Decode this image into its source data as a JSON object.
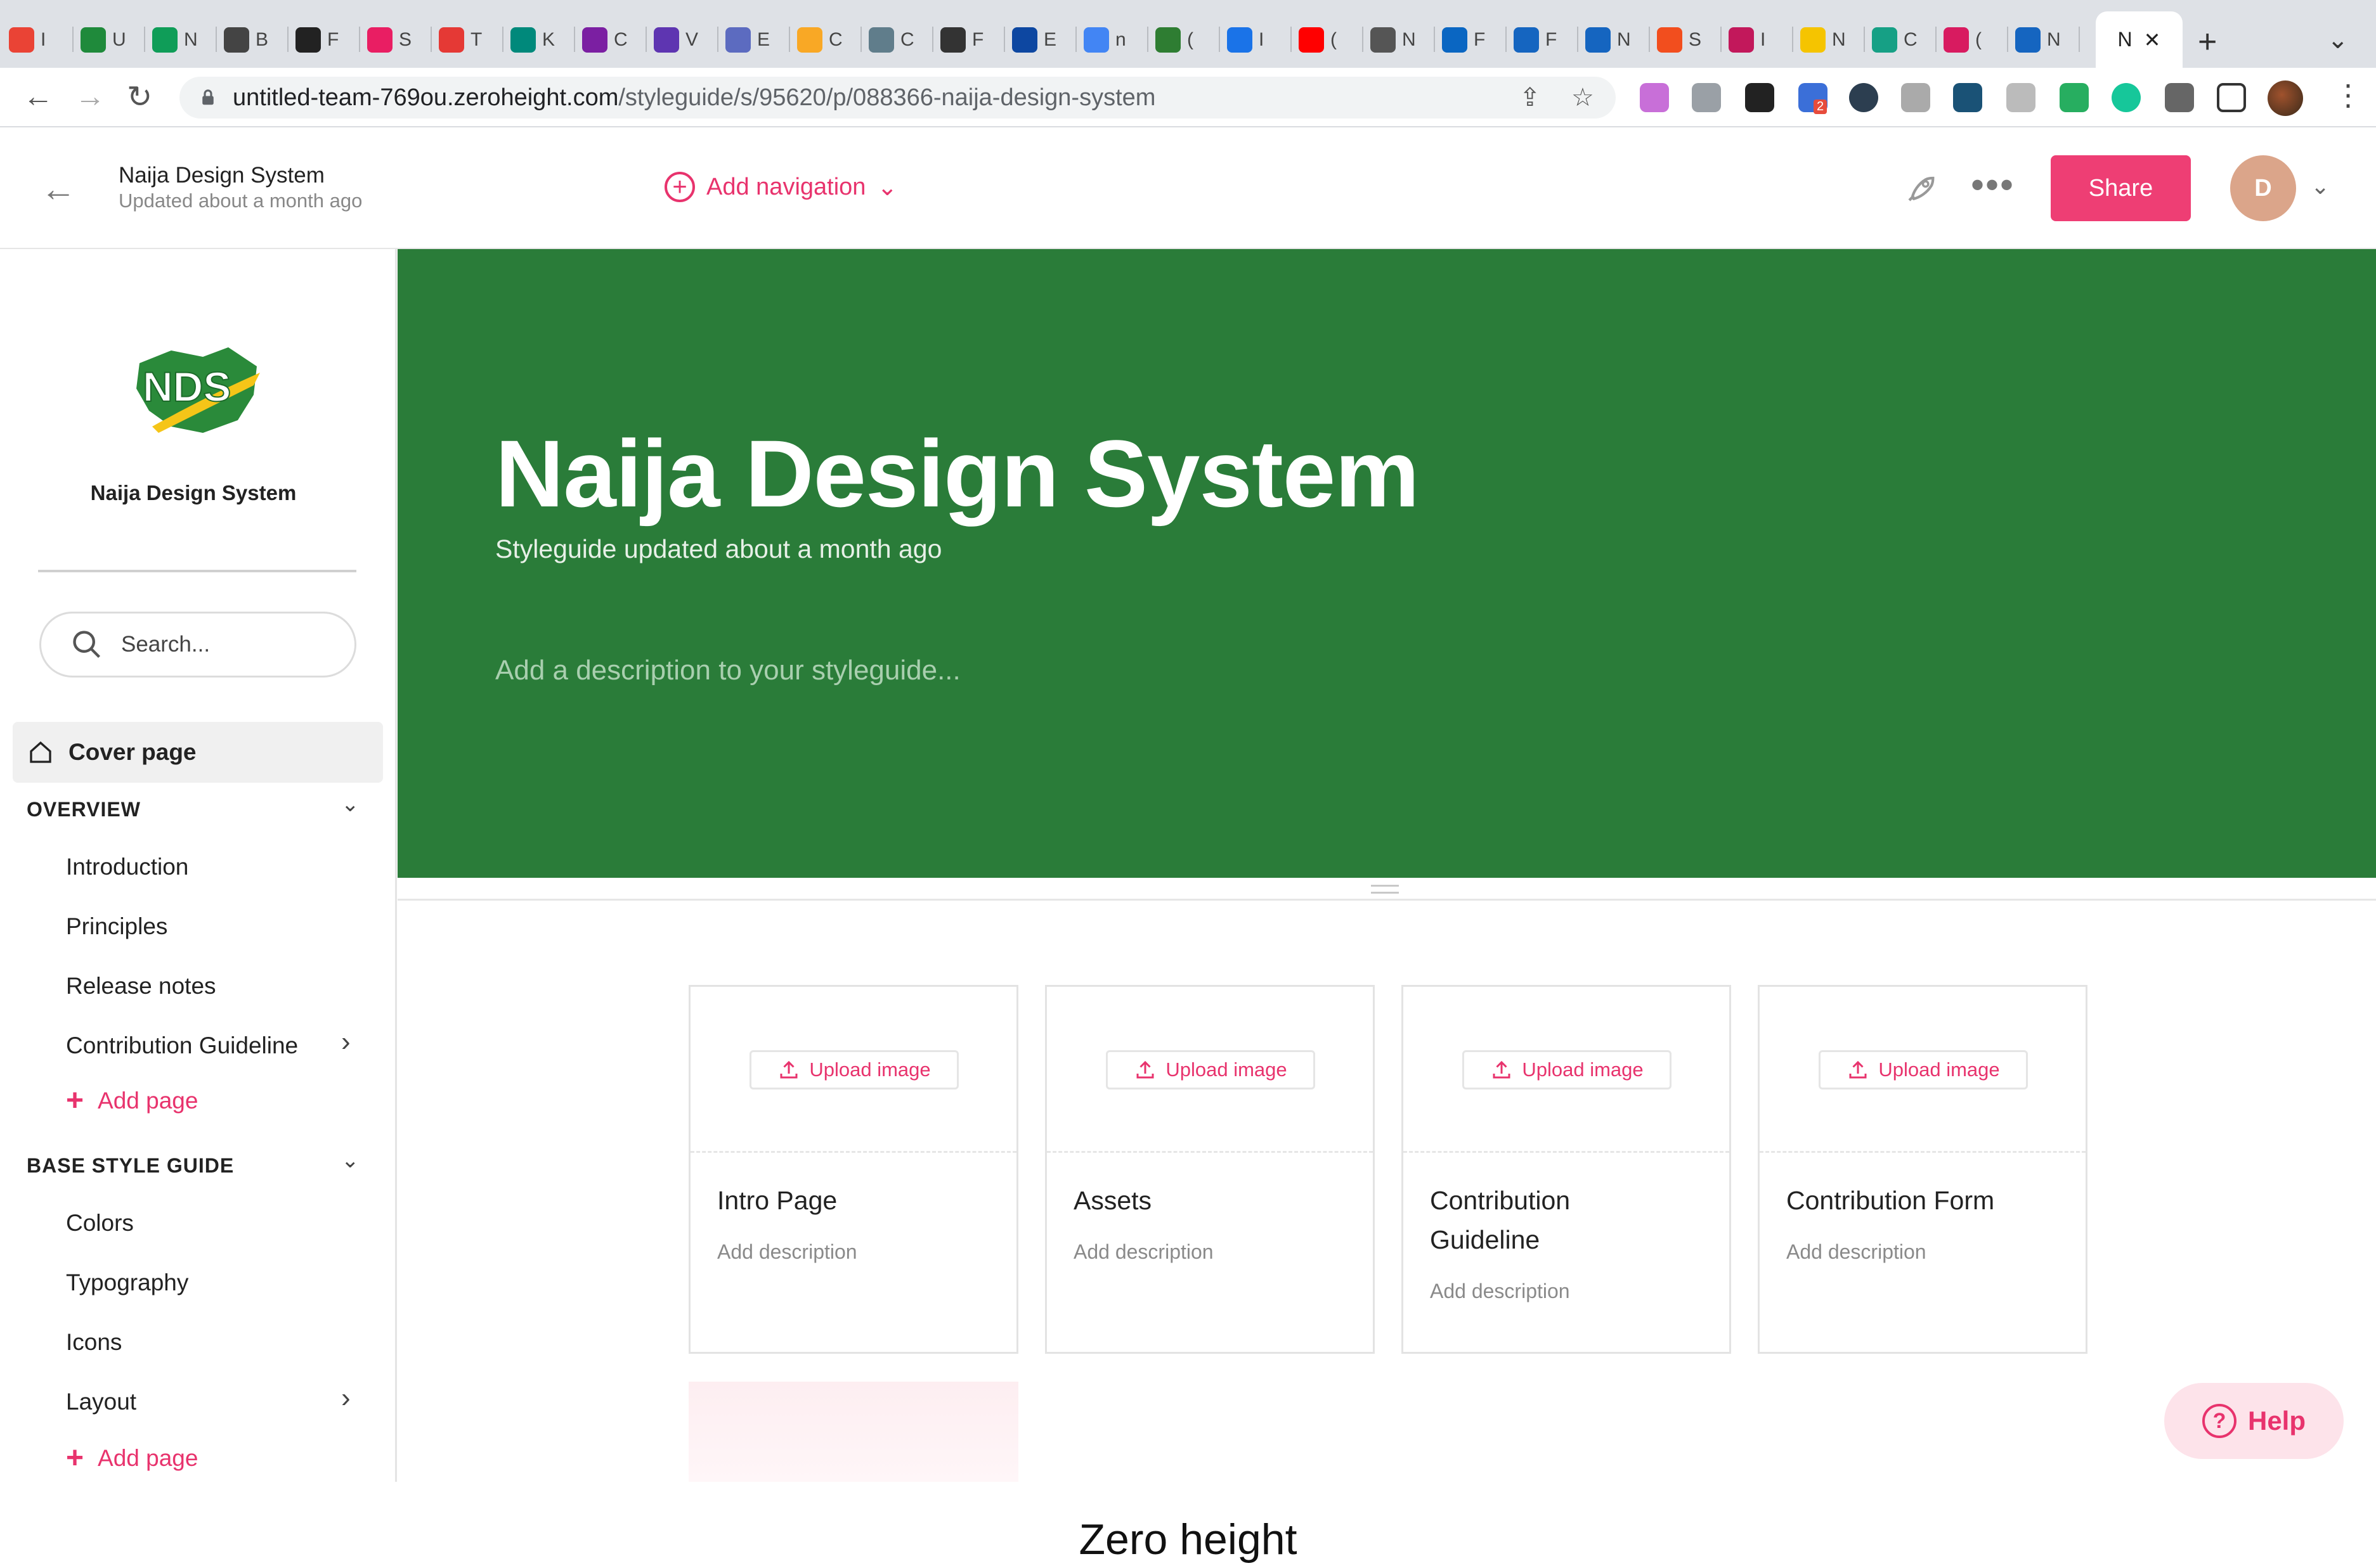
{
  "browser": {
    "tab_letters": [
      "I",
      "U",
      "N",
      "B",
      "F",
      "S",
      "T",
      "K",
      "C",
      "V",
      "E",
      "C",
      "C",
      "F",
      "E",
      "n",
      "(",
      "I",
      "(",
      "N",
      "F",
      "F",
      "N",
      "S",
      "I",
      "N",
      "C",
      "(",
      "N"
    ],
    "active_tab_letter": "N",
    "close_symbol": "✕",
    "new_tab_symbol": "+",
    "tab_list_symbol": "⌄",
    "url_host": "untitled-team-769ou.zeroheight.com",
    "url_path": "/styleguide/s/95620/p/088366-naija-design-system",
    "nav_back": "←",
    "nav_forward": "→",
    "nav_reload": "↻",
    "share_icon": "⇪",
    "star_icon": "☆",
    "menu_icon": "⋮",
    "ext_badge": "2"
  },
  "header": {
    "back_symbol": "←",
    "title": "Naija Design System",
    "subtitle": "Updated about a month ago",
    "add_navigation_plus": "+",
    "add_navigation_label": "Add navigation",
    "add_navigation_caret": "⌄",
    "rocket_symbol": "🚀",
    "more_symbol": "•••",
    "share_label": "Share",
    "avatar_initial": "D",
    "avatar_caret": "⌄"
  },
  "sidebar": {
    "logo_text": "NDS",
    "org_name": "Naija Design System",
    "search_placeholder": "Search...",
    "cover_page": "Cover page",
    "sections": [
      {
        "title": "OVERVIEW",
        "items": [
          "Introduction",
          "Principles",
          "Release notes",
          "Contribution Guideline"
        ],
        "add_page": "Add page"
      },
      {
        "title": "BASE STYLE GUIDE",
        "items": [
          "Colors",
          "Typography",
          "Icons",
          "Layout"
        ],
        "add_page": "Add page"
      }
    ],
    "chevron_down": "⌄",
    "chevron_right": "›",
    "plus": "+"
  },
  "hero": {
    "title": "Naija Design System",
    "subtitle": "Styleguide updated about a month ago",
    "description_placeholder": "Add a description to your styleguide...",
    "background_color": "#2a7c39"
  },
  "cards": [
    {
      "title": "Intro Page",
      "description": "Add description",
      "upload_label": "Upload image"
    },
    {
      "title": "Assets",
      "description": "Add description",
      "upload_label": "Upload image"
    },
    {
      "title": "Contribution Guideline",
      "description": "Add description",
      "upload_label": "Upload image"
    },
    {
      "title": "Contribution Form",
      "description": "Add description",
      "upload_label": "Upload image"
    }
  ],
  "help": {
    "symbol": "?",
    "label": "Help"
  },
  "caption": "Zero height",
  "colors": {
    "accent": "#e8336d",
    "share_button": "#ee3e74",
    "avatar": "#dba58a"
  }
}
